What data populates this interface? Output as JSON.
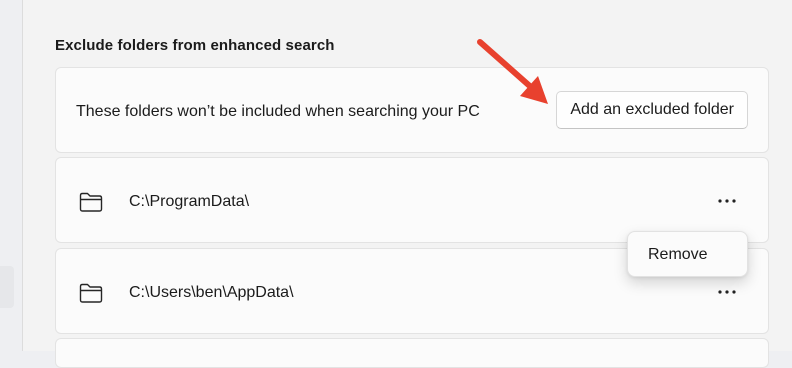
{
  "section": {
    "title": "Exclude folders from enhanced search"
  },
  "header_card": {
    "description": "These folders won’t be included when searching your PC",
    "add_button_label": "Add an excluded folder"
  },
  "folders": [
    {
      "path": "C:\\ProgramData\\",
      "icon": "folder-icon",
      "more_icon": "more-options-icon"
    },
    {
      "path": "C:\\Users\\ben\\AppData\\",
      "icon": "folder-icon",
      "more_icon": "more-options-icon"
    }
  ],
  "context_menu": {
    "items": [
      {
        "label": "Remove"
      }
    ]
  },
  "annotation": {
    "icon": "red-arrow-icon",
    "color": "#e8412e"
  },
  "colors": {
    "background": "#f3f3f3",
    "card": "#fbfbfb",
    "text": "#1b1b1b"
  }
}
